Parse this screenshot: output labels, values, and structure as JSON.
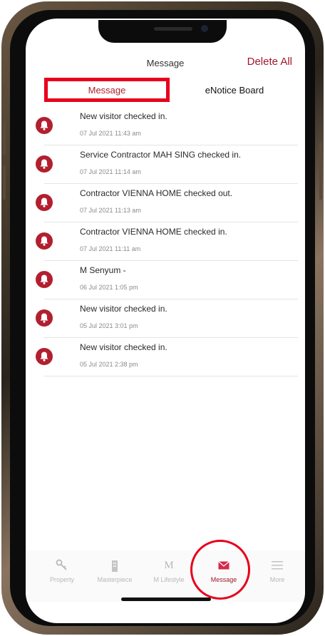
{
  "header": {
    "title": "Message",
    "delete_all": "Delete All"
  },
  "tabs": {
    "message": "Message",
    "enotice": "eNotice Board"
  },
  "messages": [
    {
      "title": "New visitor checked in.",
      "time": "07 Jul 2021 11:43 am"
    },
    {
      "title": "Service Contractor MAH SING checked in.",
      "time": "07 Jul 2021 11:14 am"
    },
    {
      "title": "Contractor VIENNA HOME checked out.",
      "time": "07 Jul 2021 11:13 am"
    },
    {
      "title": "Contractor VIENNA HOME checked in.",
      "time": "07 Jul 2021 11:11 am"
    },
    {
      "title": "M Senyum -",
      "time": "06 Jul 2021 1:05 pm"
    },
    {
      "title": "New visitor checked in.",
      "time": "05 Jul 2021 3:01 pm"
    },
    {
      "title": "New visitor checked in.",
      "time": "05 Jul 2021 2:38 pm"
    }
  ],
  "tabbar": {
    "property": {
      "label": "Property",
      "icon": "key-icon"
    },
    "masterpiece": {
      "label": "Masterpiece",
      "icon": "building-icon"
    },
    "mlifestyle": {
      "label": "M Lifestyle",
      "logo": "M"
    },
    "message": {
      "label": "Message",
      "icon": "envelope-icon"
    },
    "more": {
      "label": "More",
      "icon": "menu-icon"
    }
  },
  "colors": {
    "accent": "#a0182b",
    "highlight": "#e8001c",
    "icon_badge": "#b21f2f"
  }
}
